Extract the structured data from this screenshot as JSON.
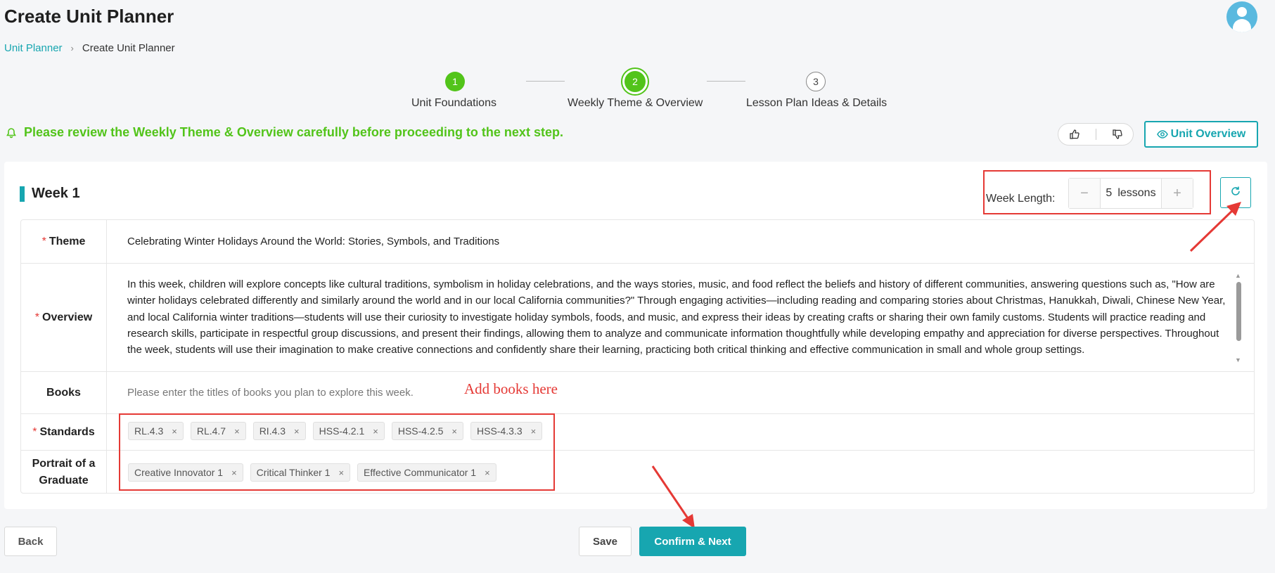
{
  "header": {
    "title": "Create Unit Planner",
    "breadcrumb": {
      "parent": "Unit Planner",
      "current": "Create Unit Planner"
    }
  },
  "steps": [
    {
      "number": "1",
      "label": "Unit Foundations",
      "status": "done"
    },
    {
      "number": "2",
      "label": "Weekly Theme & Overview",
      "status": "active"
    },
    {
      "number": "3",
      "label": "Lesson Plan Ideas & Details",
      "status": "pending"
    }
  ],
  "notice": "Please review the Weekly Theme & Overview carefully before proceeding to the next step.",
  "toolbar": {
    "unit_overview_label": "Unit Overview"
  },
  "week": {
    "title": "Week 1",
    "length_label": "Week Length:",
    "length_value": "5",
    "length_unit": "lessons",
    "decrement": "−",
    "increment": "+"
  },
  "form": {
    "theme_label": "Theme",
    "theme_value": "Celebrating Winter Holidays Around the World: Stories, Symbols, and Traditions",
    "overview_label": "Overview",
    "overview_value": "In this week, children will explore concepts like cultural traditions, symbolism in holiday celebrations, and the ways stories, music, and food reflect the beliefs and history of different communities, answering questions such as, \"How are winter holidays celebrated differently and similarly around the world and in our local California communities?\" Through engaging activities—including reading and comparing stories about Christmas, Hanukkah, Diwali, Chinese New Year, and local California winter traditions—students will use their curiosity to investigate holiday symbols, foods, and music, and express their ideas by creating crafts or sharing their own family customs. Students will practice reading and research skills, participate in respectful group discussions, and present their findings, allowing them to analyze and communicate information thoughtfully while developing empathy and appreciation for diverse perspectives. Throughout the week, students will use their imagination to make creative connections and confidently share their learning, practicing both critical thinking and effective communication in small and whole group settings.",
    "books_label": "Books",
    "books_placeholder": "Please enter the titles of books you plan to explore this week.",
    "standards_label": "Standards",
    "standards": [
      "RL.4.3",
      "RL.4.7",
      "RI.4.3",
      "HSS-4.2.1",
      "HSS-4.2.5",
      "HSS-4.3.3"
    ],
    "portrait_label": "Portrait of a Graduate",
    "portrait": [
      "Creative Innovator 1",
      "Critical Thinker 1",
      "Effective Communicator 1"
    ],
    "required_mark": "*",
    "remove_mark": "×"
  },
  "annotation": {
    "books_hint": "Add books here"
  },
  "footer": {
    "back_label": "Back",
    "save_label": "Save",
    "confirm_label": "Confirm & Next"
  },
  "colors": {
    "accent": "#17a6b0",
    "success": "#52c41a",
    "annotation": "#e53935"
  }
}
